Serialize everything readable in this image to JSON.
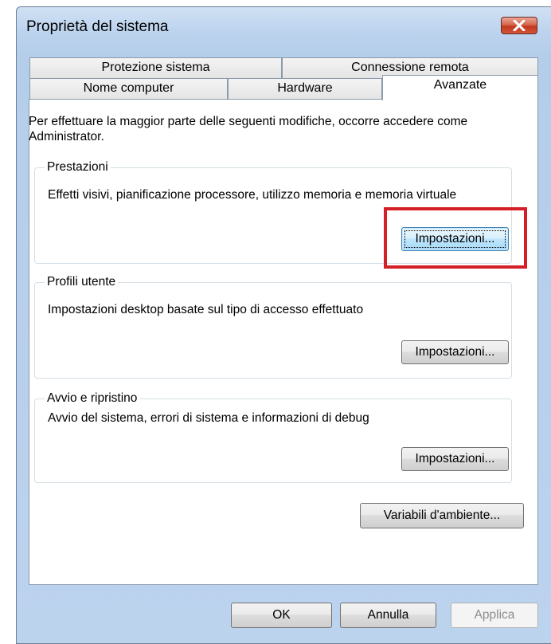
{
  "window": {
    "title": "Proprietà del sistema",
    "close_icon": "close-icon"
  },
  "tabs": {
    "row1": [
      "Protezione sistema",
      "Connessione remota"
    ],
    "row2": [
      "Nome computer",
      "Hardware",
      "Avanzate"
    ],
    "active": "Avanzate"
  },
  "intro_text": "Per effettuare la maggior parte delle seguenti modifiche, occorre accedere come Administrator.",
  "groups": {
    "performance": {
      "title": "Prestazioni",
      "description": "Effetti visivi, pianificazione processore, utilizzo memoria e memoria virtuale",
      "button_label": "Impostazioni...",
      "highlighted": true
    },
    "user_profiles": {
      "title": "Profili utente",
      "description": "Impostazioni desktop basate sul tipo di accesso effettuato",
      "button_label": "Impostazioni..."
    },
    "startup_recovery": {
      "title": "Avvio e ripristino",
      "description": "Avvio del sistema, errori di sistema e informazioni di debug",
      "button_label": "Impostazioni..."
    }
  },
  "env_button_label": "Variabili d'ambiente...",
  "footer": {
    "ok_label": "OK",
    "cancel_label": "Annulla",
    "apply_label": "Applica"
  },
  "colors": {
    "highlight": "#d41f26",
    "close_button": "#c2391f",
    "frame": "#bcd3ee"
  }
}
